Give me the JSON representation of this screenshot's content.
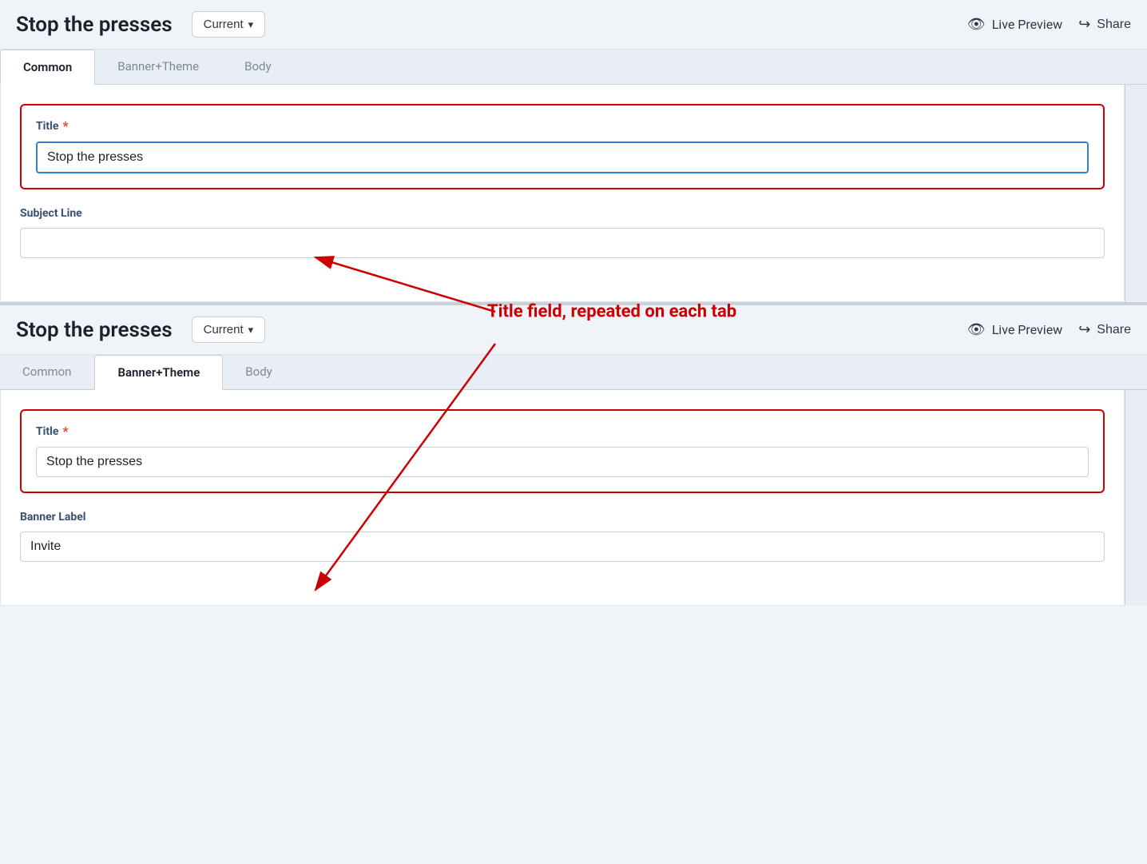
{
  "header": {
    "title": "Stop the presses",
    "dropdown_label": "Current",
    "dropdown_icon": "▾",
    "live_preview_label": "Live Preview",
    "share_label": "Share"
  },
  "tabs": {
    "items": [
      {
        "id": "common",
        "label": "Common"
      },
      {
        "id": "banner_theme",
        "label": "Banner+Theme"
      },
      {
        "id": "body",
        "label": "Body"
      }
    ]
  },
  "upper_panel": {
    "active_tab": "common",
    "title_field": {
      "label": "Title",
      "required": true,
      "value": "Stop the presses"
    },
    "subject_line_field": {
      "label": "Subject Line",
      "value": ""
    }
  },
  "lower_panel": {
    "active_tab": "banner_theme",
    "title_field": {
      "label": "Title",
      "required": true,
      "value": "Stop the presses"
    },
    "banner_label_field": {
      "label": "Banner Label",
      "value": "Invite"
    }
  },
  "annotation": {
    "text": "Title field, repeated on each tab"
  },
  "icons": {
    "eye": "👁",
    "share": "↪"
  }
}
